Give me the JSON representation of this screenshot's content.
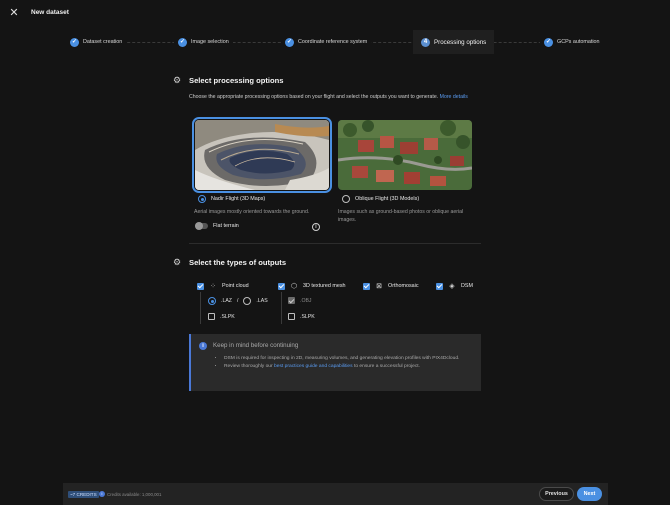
{
  "header": {
    "title": "New dataset"
  },
  "steps": [
    {
      "label": "Dataset creation",
      "status": "done"
    },
    {
      "label": "Image selection",
      "status": "done"
    },
    {
      "label": "Coordinate reference system",
      "status": "done"
    },
    {
      "number": "4",
      "label": "Processing options",
      "status": "active"
    },
    {
      "label": "GCPs automation",
      "status": "done"
    }
  ],
  "processing": {
    "title": "Select processing options",
    "description": "Choose the appropriate processing options based on your flight and select the outputs you want to generate.",
    "more_link": "More details",
    "options": [
      {
        "label": "Nadir Flight (3D Maps)",
        "description": "Aerial images mostly oriented towards the ground.",
        "selected": true
      },
      {
        "label": "Oblique Flight (3D Models)",
        "description": "Images such as ground-based photos or oblique aerial images.",
        "selected": false
      }
    ],
    "flat_terrain_label": "Flat terrain"
  },
  "outputs": {
    "title": "Select the types of outputs",
    "items": [
      {
        "label": "Point cloud",
        "checked": true,
        "icon": "point-cloud-icon"
      },
      {
        "label": "3D textured mesh",
        "checked": true,
        "icon": "mesh-icon"
      },
      {
        "label": "Orthomosaic",
        "checked": true,
        "icon": "orthomosaic-icon"
      },
      {
        "label": "DSM",
        "checked": true,
        "icon": "dsm-icon"
      }
    ],
    "point_cloud": {
      "laz": ".LAZ",
      "sep": "/",
      "las": ".LAS",
      "slpk": ".SLPK"
    },
    "mesh": {
      "obj": ".OBJ",
      "slpk": ".SLPK"
    }
  },
  "notice": {
    "title": "Keep in mind before continuing",
    "bullet1": "DSM is required for inspecting in 2D, measuring volumes, and generating elevation profiles with PIX4Dcloud.",
    "bullet2_pre": "Review thoroughly our ",
    "bullet2_link": "best practices guide and capabilities",
    "bullet2_post": " to ensure a successful project."
  },
  "footer": {
    "credits_badge": "~7 CREDITS",
    "credits_available": "Credits available: 1,000,001",
    "previous": "Previous",
    "next": "Next"
  },
  "colors": {
    "accent": "#4a90e2",
    "background": "#141414"
  }
}
